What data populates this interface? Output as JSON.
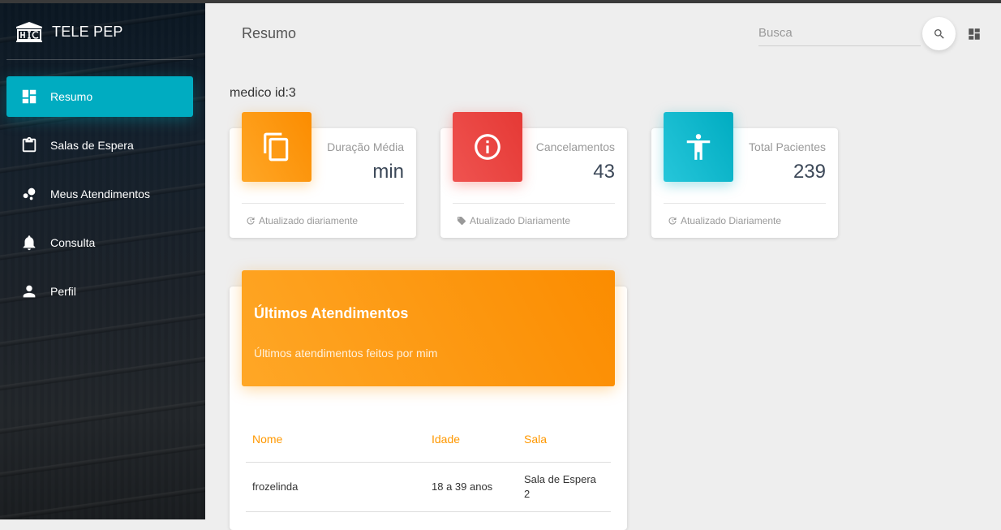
{
  "app": {
    "name": "TELE PEP"
  },
  "sidebar": {
    "items": [
      {
        "label": "Resumo",
        "icon": "dashboard-icon",
        "active": true
      },
      {
        "label": "Salas de Espera",
        "icon": "clipboard-icon",
        "active": false
      },
      {
        "label": "Meus Atendimentos",
        "icon": "bubble-chart-icon",
        "active": false
      },
      {
        "label": "Consulta",
        "icon": "bell-icon",
        "active": false
      },
      {
        "label": "Perfil",
        "icon": "person-icon",
        "active": false
      }
    ]
  },
  "header": {
    "title": "Resumo",
    "search_placeholder": "Busca",
    "search_icon": "search-icon",
    "dashboard_icon": "dashboard-icon"
  },
  "medico_label": "medico id:3",
  "stats": [
    {
      "category": "Duração Média",
      "value": "min",
      "footer": "Atualizado diariamente",
      "icon": "copy-icon",
      "footer_icon": "update-icon",
      "color": "#fb8c00"
    },
    {
      "category": "Cancelamentos",
      "value": "43",
      "footer": "Atualizado Diariamente",
      "icon": "info-icon",
      "footer_icon": "tag-icon",
      "color": "#e53935"
    },
    {
      "category": "Total Pacientes",
      "value": "239",
      "footer": "Atualizado Diariamente",
      "icon": "accessibility-icon",
      "footer_icon": "update-icon",
      "color": "#00acc1"
    }
  ],
  "atendimentos": {
    "title": "Últimos Atendimentos",
    "subtitle": "Últimos atendimentos feitos por mim",
    "columns": [
      "Nome",
      "Idade",
      "Sala"
    ],
    "rows": [
      {
        "nome": "frozelinda",
        "idade": "18 a 39 anos",
        "sala": "Sala de Espera 2"
      }
    ]
  },
  "colors": {
    "accent_cyan": "#00acc1",
    "accent_orange": "#ff9800",
    "accent_red": "#e53935"
  }
}
